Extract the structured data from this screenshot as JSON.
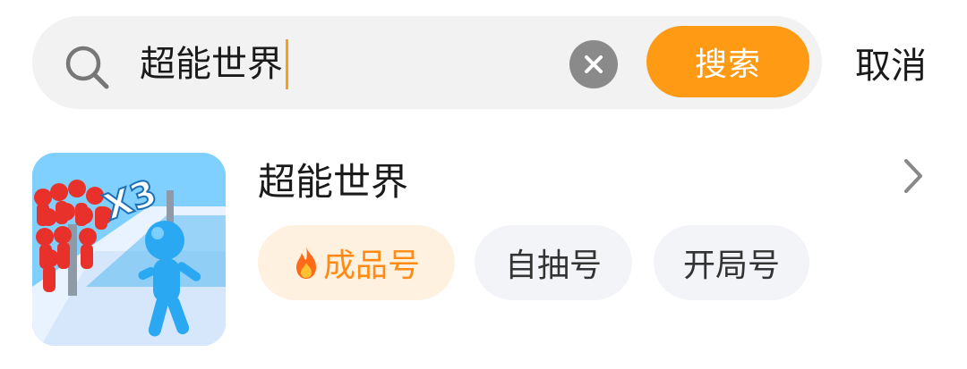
{
  "search": {
    "query": "超能世界",
    "button_label": "搜索",
    "cancel_label": "取消"
  },
  "result": {
    "title": "超能世界",
    "icon": "game-thumbnail",
    "tags": [
      {
        "label": "成品号",
        "icon": "fire-icon"
      },
      {
        "label": "自抽号"
      },
      {
        "label": "开局号"
      }
    ]
  },
  "colors": {
    "accent": "#ff9a14",
    "search_bg": "#f2f2f2",
    "tag_highlight_bg": "#fff1e0",
    "tag_highlight_text": "#ff8a14",
    "tag_bg": "#f3f4f7"
  }
}
